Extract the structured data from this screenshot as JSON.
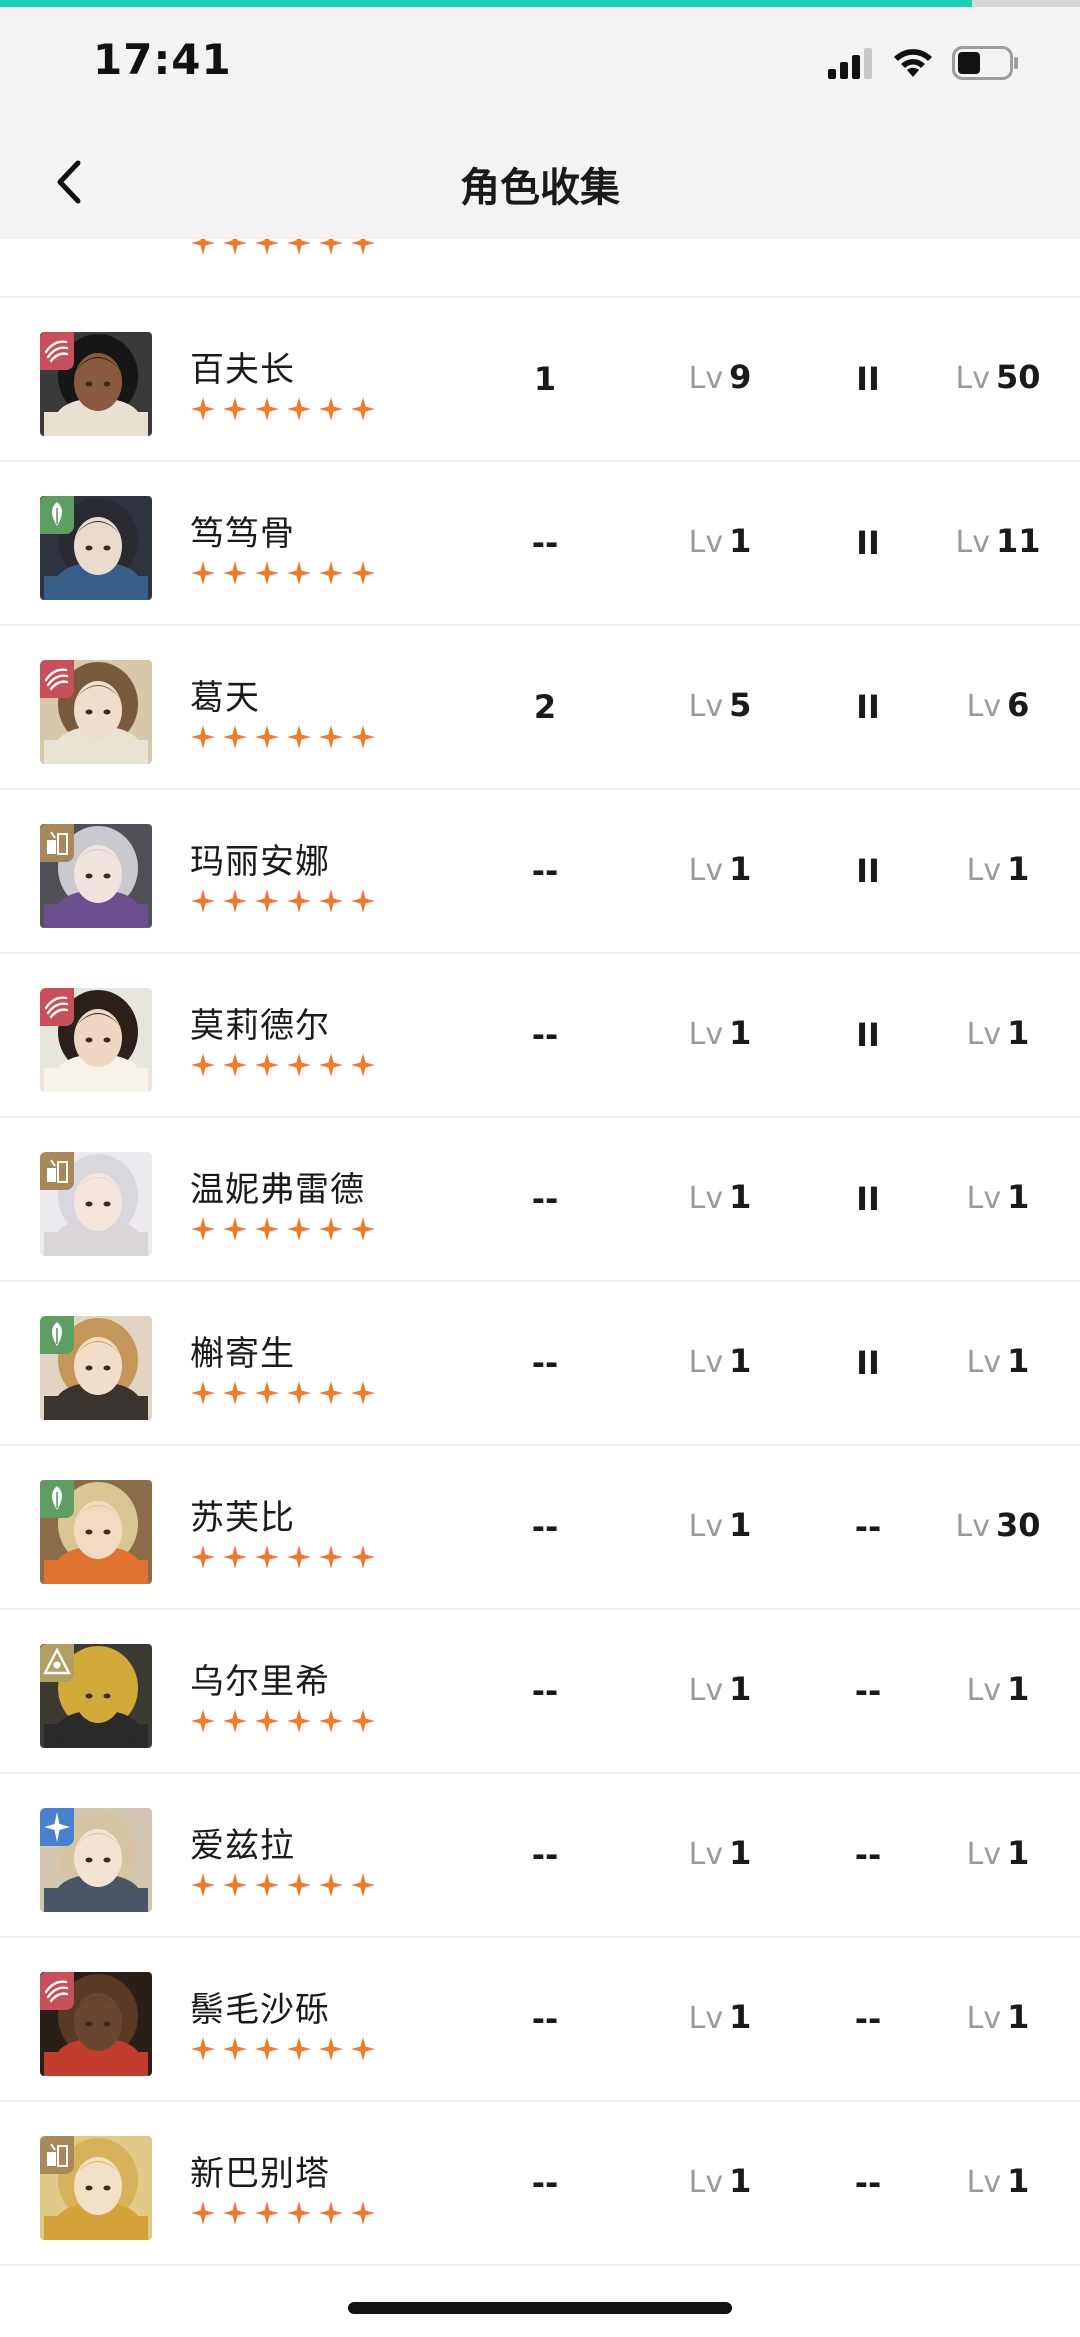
{
  "status_bar": {
    "time": "17:41",
    "battery_level": 0.45
  },
  "progress": {
    "fraction": 0.9,
    "color": "#1ecfb4"
  },
  "header": {
    "title": "角色收集",
    "back_icon": "chevron-left-icon"
  },
  "colors": {
    "star": "#ee7a2e",
    "lv_prefix": "#9a9a9a"
  },
  "lv_prefix": "Lv",
  "rows": [
    {
      "name": "百夫长",
      "element": "beast",
      "stars": 6,
      "col_a": "1",
      "level": "9",
      "col_c": "II",
      "level2": "50"
    },
    {
      "name": "笃笃骨",
      "element": "plant",
      "stars": 6,
      "col_a": "--",
      "level": "1",
      "col_c": "II",
      "level2": "11"
    },
    {
      "name": "葛天",
      "element": "beast",
      "stars": 6,
      "col_a": "2",
      "level": "5",
      "col_c": "II",
      "level2": "6"
    },
    {
      "name": "玛丽安娜",
      "element": "mineral",
      "stars": 6,
      "col_a": "--",
      "level": "1",
      "col_c": "II",
      "level2": "1"
    },
    {
      "name": "莫莉德尔",
      "element": "beast",
      "stars": 6,
      "col_a": "--",
      "level": "1",
      "col_c": "II",
      "level2": "1"
    },
    {
      "name": "温妮弗雷德",
      "element": "mineral",
      "stars": 6,
      "col_a": "--",
      "level": "1",
      "col_c": "II",
      "level2": "1"
    },
    {
      "name": "槲寄生",
      "element": "plant",
      "stars": 6,
      "col_a": "--",
      "level": "1",
      "col_c": "II",
      "level2": "1"
    },
    {
      "name": "苏芙比",
      "element": "plant",
      "stars": 6,
      "col_a": "--",
      "level": "1",
      "col_c": "--",
      "level2": "30"
    },
    {
      "name": "乌尔里希",
      "element": "intellect",
      "stars": 6,
      "col_a": "--",
      "level": "1",
      "col_c": "--",
      "level2": "1"
    },
    {
      "name": "爱兹拉",
      "element": "star",
      "stars": 6,
      "col_a": "--",
      "level": "1",
      "col_c": "--",
      "level2": "1"
    },
    {
      "name": "鬃毛沙砾",
      "element": "beast",
      "stars": 6,
      "col_a": "--",
      "level": "1",
      "col_c": "--",
      "level2": "1"
    },
    {
      "name": "新巴别塔",
      "element": "mineral",
      "stars": 6,
      "col_a": "--",
      "level": "1",
      "col_c": "--",
      "level2": "1"
    }
  ],
  "element_colors": {
    "beast": "#c8505a",
    "plant": "#5e9e63",
    "mineral": "#a8875a",
    "intellect": "#b29f63",
    "star": "#4a7fcf"
  }
}
